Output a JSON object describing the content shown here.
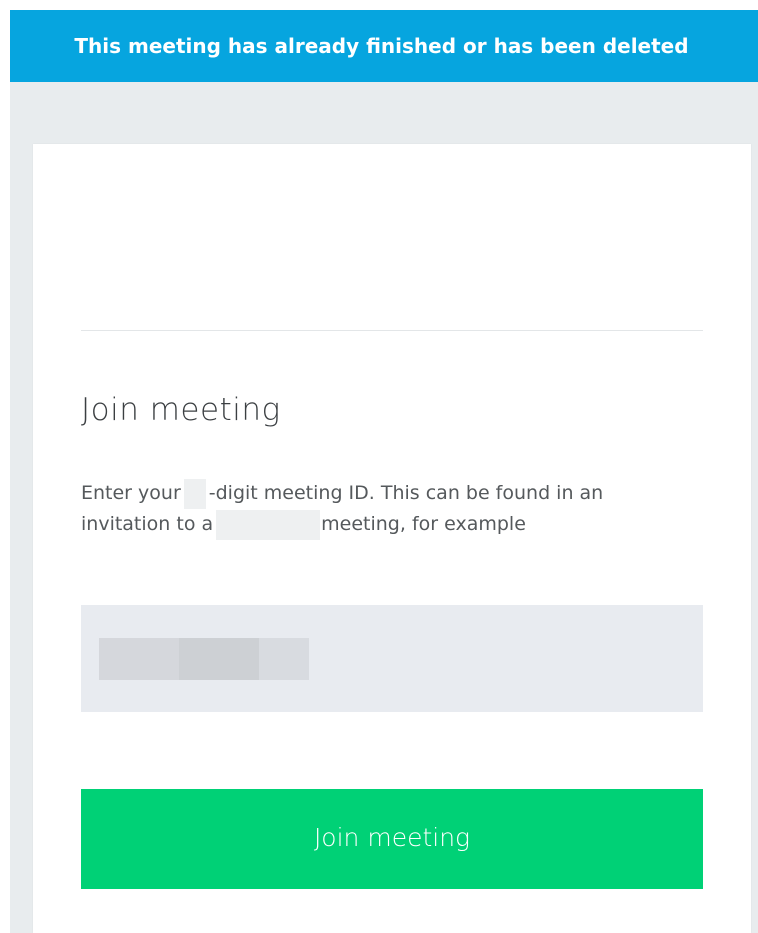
{
  "banner": {
    "message": "This meeting has already finished or has been deleted"
  },
  "join_form": {
    "title": "Join meeting",
    "instructions": {
      "line1_before": "Enter your",
      "line1_after": "-digit meeting ID. This can be found in an",
      "line2_before": "invitation to a",
      "line2_after": "meeting, for example"
    },
    "meeting_id_input": {
      "value": "",
      "placeholder": ""
    },
    "submit_label": "Join meeting"
  },
  "colors": {
    "banner": "#06a5df",
    "backdrop": "#e8ecee",
    "card": "#ffffff",
    "input": "#e8ebf0",
    "button": "#00d176"
  }
}
